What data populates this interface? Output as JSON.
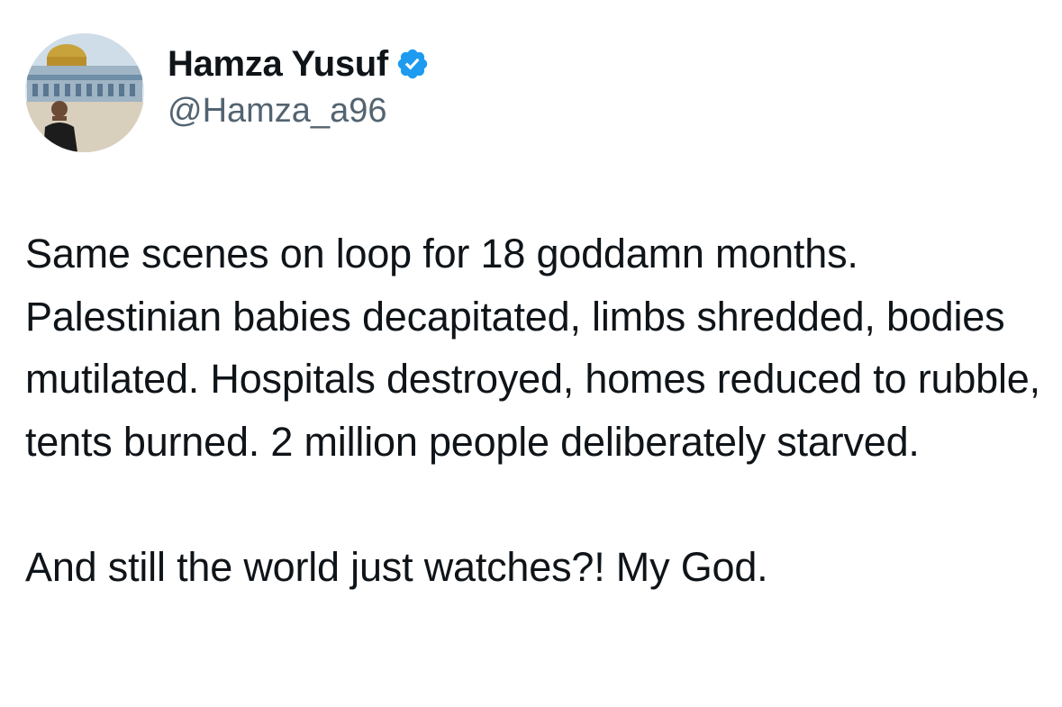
{
  "tweet": {
    "author": {
      "display_name": "Hamza Yusuf",
      "handle": "@Hamza_a96",
      "verified": true,
      "verified_icon": "verified-badge-icon",
      "avatar": "avatar-photo"
    },
    "paragraphs": [
      "Same scenes on loop for 18 goddamn months. Palestinian babies decapitated, limbs shredded, bodies mutilated. Hospitals destroyed, homes reduced to rubble, tents burned. 2 million people deliberately starved.",
      "And still the world just watches?! My God."
    ]
  },
  "colors": {
    "text": "#0f1419",
    "handle": "#536471",
    "verified": "#1d9bf0",
    "background": "#ffffff"
  }
}
